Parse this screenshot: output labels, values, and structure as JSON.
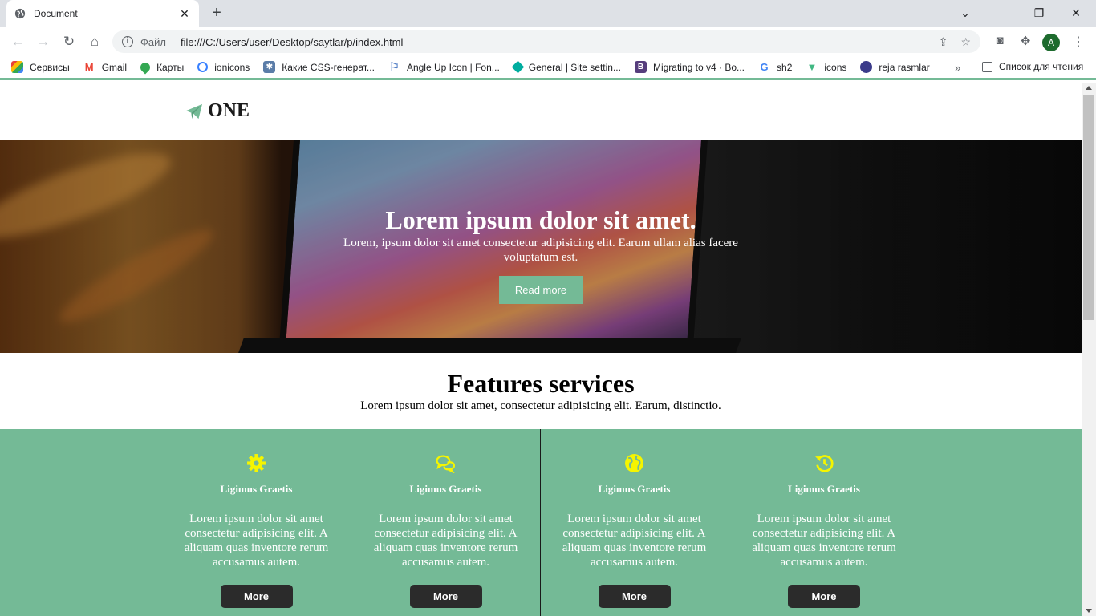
{
  "browser": {
    "tab_title": "Document",
    "tab_close": "✕",
    "new_tab": "+",
    "minimize": "—",
    "restore": "❐",
    "close": "✕",
    "collapse": "⌄",
    "protocol_label": "Файл",
    "url": "file:///C:/Users/user/Desktop/saytlar/p/index.html",
    "avatar_letter": "A",
    "bookmarks": [
      {
        "label": "Сервисы",
        "icon": "apps-grid-icon",
        "color": "#4285f4"
      },
      {
        "label": "Gmail",
        "icon": "gmail-icon",
        "color": "#ea4335"
      },
      {
        "label": "Карты",
        "icon": "maps-pin-icon",
        "color": "#34a853"
      },
      {
        "label": "ionicons",
        "icon": "ionicons-icon",
        "color": "#3880ff"
      },
      {
        "label": "Какие CSS-генерат...",
        "icon": "habr-icon",
        "color": "#5b7da8"
      },
      {
        "label": "Angle Up Icon | Fon...",
        "icon": "flag-icon",
        "color": "#4a78c2"
      },
      {
        "label": "General | Site settin...",
        "icon": "netlify-icon",
        "color": "#00ad9f"
      },
      {
        "label": "Migrating to v4 · Bo...",
        "icon": "bootstrap-icon",
        "color": "#563d7c"
      },
      {
        "label": "sh2",
        "icon": "google-icon",
        "color": "#4285f4"
      },
      {
        "label": "icons",
        "icon": "vue-icon",
        "color": "#41b883"
      },
      {
        "label": "reja rasmlar",
        "icon": "circle-icon",
        "color": "#3b3b8a"
      }
    ],
    "bookmarks_more": "»",
    "reading_list": "Список для чтения"
  },
  "site": {
    "logo_text": "ONE",
    "hero": {
      "title": "Lorem ipsum dolor sit amet.",
      "subtitle": "Lorem, ipsum dolor sit amet consectetur adipisicing elit. Earum ullam alias facere voluptatum est.",
      "button": "Read more"
    },
    "features": {
      "title": "Features services",
      "subtitle": "Lorem ipsum dolor sit amet, consectetur adipisicing elit. Earum, distinctio."
    },
    "cards": [
      {
        "icon": "gear-icon",
        "title": "Ligimus Graetis",
        "text": "Lorem ipsum dolor sit amet consectetur adipisicing elit. A aliquam quas inventore rerum accusamus autem.",
        "button": "More"
      },
      {
        "icon": "comments-icon",
        "title": "Ligimus Graetis",
        "text": "Lorem ipsum dolor sit amet consectetur adipisicing elit. A aliquam quas inventore rerum accusamus autem.",
        "button": "More"
      },
      {
        "icon": "globe-icon",
        "title": "Ligimus Graetis",
        "text": "Lorem ipsum dolor sit amet consectetur adipisicing elit. A aliquam quas inventore rerum accusamus autem.",
        "button": "More"
      },
      {
        "icon": "history-icon",
        "title": "Ligimus Graetis",
        "text": "Lorem ipsum dolor sit amet consectetur adipisicing elit. A aliquam quas inventore rerum accusamus autem.",
        "button": "More"
      }
    ],
    "colors": {
      "accent": "#74ba96",
      "icon_yellow": "#f5f500",
      "button_dark": "#2b2b2b"
    }
  }
}
